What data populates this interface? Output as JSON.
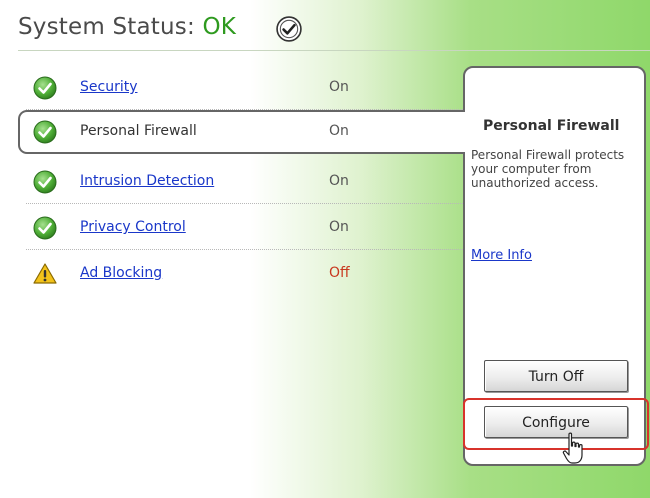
{
  "header": {
    "label": "System Status: ",
    "value": "OK",
    "icon": "check-circle-icon"
  },
  "features": [
    {
      "name": "Security",
      "status": "On",
      "icon": "check-circle-icon",
      "selected": false
    },
    {
      "name": "Personal Firewall",
      "status": "On",
      "icon": "check-circle-icon",
      "selected": true
    },
    {
      "name": "Intrusion Detection",
      "status": "On",
      "icon": "check-circle-icon",
      "selected": false
    },
    {
      "name": "Privacy Control",
      "status": "On",
      "icon": "check-circle-icon",
      "selected": false
    },
    {
      "name": "Ad Blocking",
      "status": "Off",
      "icon": "warning-icon",
      "selected": false
    }
  ],
  "detail": {
    "title": "Personal Firewall",
    "description": "Personal Firewall protects your computer from unauthorized access.",
    "more_info": "More Info",
    "turn_off": "Turn Off",
    "configure": "Configure"
  },
  "colors": {
    "ok_green": "#2e9a1f",
    "link_blue": "#1a37c9",
    "off_red": "#c8381e",
    "highlight_red": "#d8332b"
  }
}
